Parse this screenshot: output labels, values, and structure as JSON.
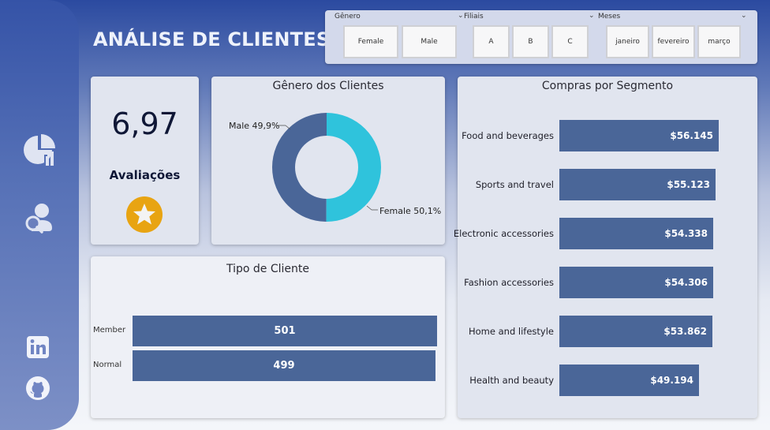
{
  "title": "ANÁLISE DE CLIENTES",
  "filters": [
    {
      "label": "Gênero",
      "options": [
        "Female",
        "Male"
      ]
    },
    {
      "label": "Filiais",
      "options": [
        "A",
        "B",
        "C"
      ]
    },
    {
      "label": "Meses",
      "options": [
        "janeiro",
        "fevereiro",
        "março"
      ]
    }
  ],
  "sidebar": {
    "icons": [
      "pie-chart-icon",
      "user-search-icon",
      "linkedin-icon",
      "github-icon"
    ]
  },
  "rating": {
    "value": "6,97",
    "label": "Avaliações",
    "icon": "star-icon",
    "color": "#e8a412"
  },
  "gender": {
    "title": "Gênero dos Clientes",
    "male_label": "Male 49,9%",
    "female_label": "Female 50,1%"
  },
  "customer_type": {
    "title": "Tipo de Cliente",
    "rows": [
      {
        "label": "Member",
        "value": "501"
      },
      {
        "label": "Normal",
        "value": "499"
      }
    ]
  },
  "segments": {
    "title": "Compras por Segmento",
    "rows": [
      {
        "label": "Food and beverages",
        "value": "$56.145"
      },
      {
        "label": "Sports and travel",
        "value": "$55.123"
      },
      {
        "label": "Electronic accessories",
        "value": "$54.338"
      },
      {
        "label": "Fashion accessories",
        "value": "$54.306"
      },
      {
        "label": "Home and lifestyle",
        "value": "$53.862"
      },
      {
        "label": "Health and beauty",
        "value": "$49.194"
      }
    ]
  },
  "chart_data": [
    {
      "type": "pie",
      "title": "Gênero dos Clientes",
      "categories": [
        "Male",
        "Female"
      ],
      "values": [
        49.9,
        50.1
      ],
      "colors": [
        "#4a6698",
        "#2fc3dc"
      ]
    },
    {
      "type": "bar",
      "title": "Tipo de Cliente",
      "categories": [
        "Member",
        "Normal"
      ],
      "values": [
        501,
        499
      ]
    },
    {
      "type": "bar",
      "title": "Compras por Segmento",
      "categories": [
        "Food and beverages",
        "Sports and travel",
        "Electronic accessories",
        "Fashion accessories",
        "Home and lifestyle",
        "Health and beauty"
      ],
      "values": [
        56145,
        55123,
        54338,
        54306,
        53862,
        49194
      ]
    }
  ],
  "colors": {
    "bar": "#4a6698",
    "accent": "#2fc3dc",
    "star": "#e8a412"
  }
}
